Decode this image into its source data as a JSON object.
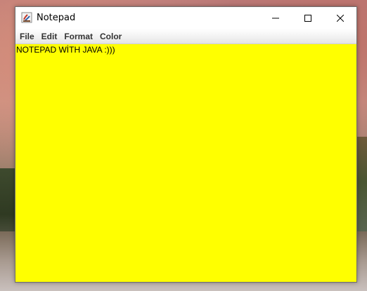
{
  "window": {
    "title": "Notepad",
    "app_icon": "java-app-icon",
    "controls": {
      "minimize": "minimize-icon",
      "maximize": "maximize-icon",
      "close": "close-icon"
    }
  },
  "menubar": {
    "items": [
      {
        "label": "File"
      },
      {
        "label": "Edit"
      },
      {
        "label": "Format"
      },
      {
        "label": "Color"
      }
    ]
  },
  "editor": {
    "text": "NOTEPAD WİTH JAVA :)))",
    "background_color": "#ffff00",
    "text_color": "#000000"
  }
}
